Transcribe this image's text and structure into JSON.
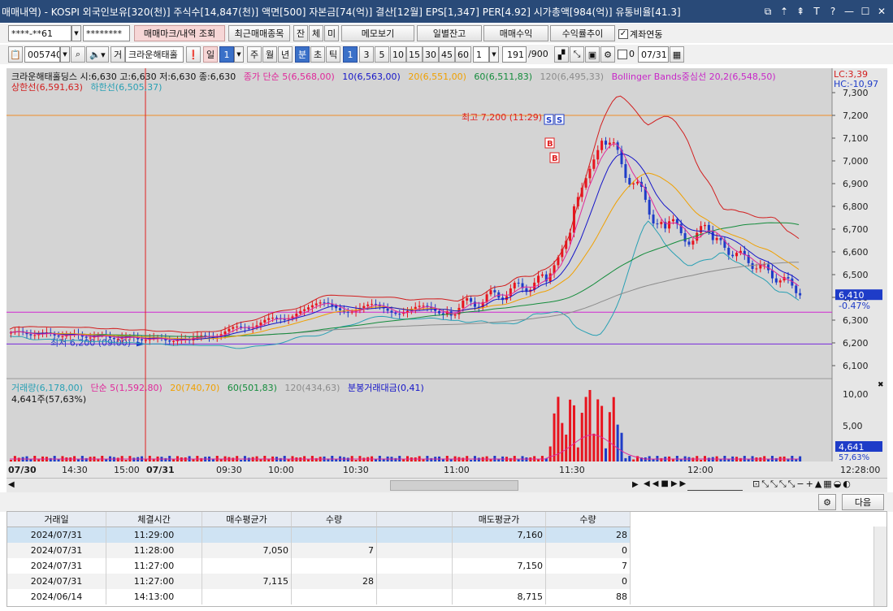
{
  "title": "매매내역) - KOSPI 외국인보유[320(천)] 주식수[14,847(천)] 액면[500] 자본금[74(억)] 결산[12월] EPS[1,347] PER[4.92] 시가총액[984(억)] 유통비율[41.3]",
  "window_icons": [
    "⧉",
    "⇡",
    "⇞",
    "T",
    "?",
    "—",
    "☐",
    "✕"
  ],
  "toolbar1": {
    "account": "****-**61",
    "password": "********",
    "tab_active": "매매마크/내역 조회",
    "recent_trades": "최근매매종목",
    "btn_jan": "잔",
    "btn_che": "체",
    "btn_mi": "미",
    "memo": "메모보기",
    "daily_balance": "일별잔고",
    "trade_profit": "매매수익",
    "return_trend": "수익률추이",
    "link_account": "계좌연동"
  },
  "toolbar2": {
    "code": "005740",
    "broker_tag": "거",
    "stock_name": "크라운해태홀",
    "periods": [
      "일",
      "주",
      "월",
      "년",
      "분",
      "초",
      "틱"
    ],
    "period_value": "1",
    "active_period": "분",
    "intervals": [
      "1",
      "3",
      "5",
      "10",
      "15",
      "30",
      "45",
      "60"
    ],
    "interval_value": "1",
    "count": "191",
    "count_max": "/900",
    "date_prefix": "0",
    "date": "07/31"
  },
  "chart": {
    "ohlc_text": "크라운해태홀딩스 시:6,630 고:6,630 저:6,630 종:6,630",
    "ma_label": "종가 단순 5(6,568,00)",
    "ma10": "10(6,563,00)",
    "ma20": "20(6,551,00)",
    "ma60": "60(6,511,83)",
    "ma120": "120(6,495,33)",
    "bb_label": "Bollinger Bands중심선 20,2(6,548,50)",
    "upper_band": "상한선(6,591,63)",
    "lower_band": "하한선(6,505,37)",
    "lc": "LC:3,39",
    "hc": "HC:-10,97",
    "high_label": "최고 7,200 (11:29)",
    "low_label": "최저 6,200 (09:00)",
    "price_ticks": [
      "7,300",
      "7,200",
      "7,100",
      "7,000",
      "6,900",
      "6,800",
      "6,700",
      "6,600",
      "6,500",
      "6,400",
      "6,300",
      "6,200",
      "6,100"
    ],
    "current_price": "6,410",
    "current_change": "-0.47%",
    "vol_label": "거래량(6,178,00)",
    "vol_ma5": "단순 5(1,592,80)",
    "vol_ma20": "20(740,70)",
    "vol_ma60": "60(501,83)",
    "vol_ma120": "120(434,63)",
    "vol_amount": "분봉거래대금(0,41)",
    "vol_sub": "4,641주(57,63%)",
    "vol_ticks": [
      "10,00",
      "5,00"
    ],
    "vol_current": "4,641",
    "vol_pct": "57,63%",
    "time_labels": [
      "07/30",
      "14:30",
      "15:00",
      "07/31",
      "09:30",
      "10:00",
      "10:30",
      "11:00",
      "11:30",
      "12:00"
    ],
    "time_right": "12:28:00",
    "marker_s": "S",
    "marker_b": "B",
    "close_icon": "✖"
  },
  "table": {
    "next": "다음",
    "headers": [
      "거래일",
      "체결시간",
      "매수평균가",
      "수량",
      "",
      "매도평균가",
      "수량"
    ],
    "rows": [
      [
        "2024/07/31",
        "11:29:00",
        "",
        "",
        "",
        "7,160",
        "28"
      ],
      [
        "2024/07/31",
        "11:28:00",
        "7,050",
        "7",
        "",
        "",
        "0"
      ],
      [
        "2024/07/31",
        "11:27:00",
        "",
        "",
        "",
        "7,150",
        "7"
      ],
      [
        "2024/07/31",
        "11:27:00",
        "7,115",
        "28",
        "",
        "",
        "0"
      ],
      [
        "2024/06/14",
        "14:13:00",
        "",
        "",
        "",
        "8,715",
        "88"
      ]
    ]
  },
  "colors": {
    "title_bg": "#294a78",
    "chart_bg": "#d4d4d4",
    "up": "#e8141e",
    "down": "#1e3cc8",
    "ma5": "#e0289a",
    "ma10": "#1414c8",
    "ma20": "#f0a000",
    "ma60": "#148c3c",
    "ma120": "#8c8c8c",
    "bb": "#d21e1e",
    "bb_lower": "#28a0b4",
    "selected_row": "#cfe3f3"
  }
}
